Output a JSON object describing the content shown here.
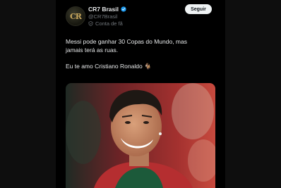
{
  "post": {
    "author": {
      "name": "CR7 Brasil",
      "handle": "@CR7Brasil",
      "account_label": "Conta de fã",
      "avatar_text": "CR"
    },
    "follow_label": "Seguir",
    "text_lines": [
      "Messi pode ganhar 30 Copas do Mundo, mas",
      "jamais terá as ruas.",
      "Eu te amo Cristiano Ronaldo 🐐"
    ],
    "media": {
      "subject": "Cristiano Ronaldo smiling in Portugal jersey"
    }
  },
  "colors": {
    "background": "#000000",
    "text": "#e7e9ea",
    "muted": "#71767b",
    "verified": "#1d9bf0",
    "follow_bg": "#eff3f4"
  }
}
